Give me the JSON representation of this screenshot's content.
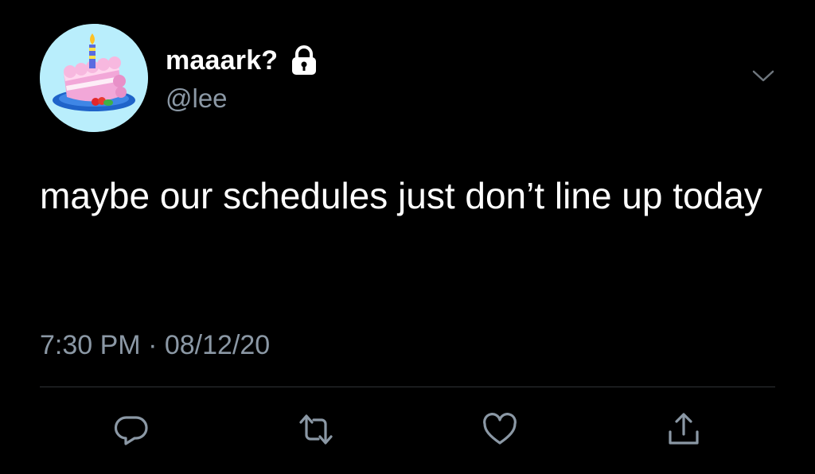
{
  "tweet": {
    "author": {
      "display_name": "maaark?",
      "handle": "@lee",
      "protected": true,
      "avatar_icon": "birthday-cake-icon",
      "avatar_bg": "#b9eefc"
    },
    "text": "maybe our schedules just don’t line up today",
    "time": "7:30 PM",
    "separator": "·",
    "date": "08/12/20"
  },
  "actions": [
    {
      "name": "reply",
      "icon": "reply-icon"
    },
    {
      "name": "retweet",
      "icon": "retweet-icon"
    },
    {
      "name": "like",
      "icon": "heart-icon"
    },
    {
      "name": "share",
      "icon": "share-icon"
    }
  ],
  "colors": {
    "background": "#000000",
    "text": "#ffffff",
    "secondary_text": "#8b98a5",
    "divider": "#2f3336"
  }
}
